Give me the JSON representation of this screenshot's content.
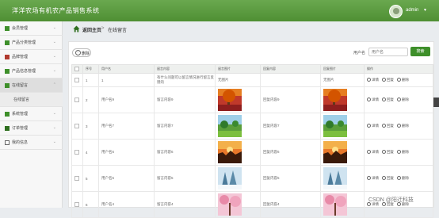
{
  "header": {
    "title": "洋洋农场有机农产品销售系统",
    "user": "admin"
  },
  "sidebar": {
    "items": [
      {
        "label": "会员管理"
      },
      {
        "label": "产品分类管理"
      },
      {
        "label": "品牌管理"
      },
      {
        "label": "产品信息管理"
      },
      {
        "label": "在线留言"
      },
      {
        "label": "在线留言",
        "sub": true
      },
      {
        "label": "系统管理"
      },
      {
        "label": "订单管理"
      },
      {
        "label": "我的信息"
      }
    ]
  },
  "breadcrumb": {
    "home": "返回主页",
    "separator": ">",
    "current": "在线留言"
  },
  "toolbar": {
    "delete_label": "删除",
    "search_label": "用户名",
    "search_placeholder": "用户名",
    "search_button": "搜索"
  },
  "table": {
    "columns": [
      "",
      "序号",
      "用户名",
      "留言内容",
      "留言图片",
      "回复内容",
      "回复图片",
      "操作"
    ],
    "no_image_text": "无图片",
    "actions": {
      "detail": "详情",
      "reply": "回复",
      "delete": "删除"
    },
    "rows": [
      {
        "index": "1",
        "user": "1",
        "content": "有什么问题可以留言情况进行留言反馈的",
        "image": "none",
        "reply": "",
        "reply_image": "none"
      },
      {
        "index": "2",
        "user": "用户名9",
        "content": "留言内容9",
        "image": "autumn",
        "reply": "回复内容9",
        "reply_image": "autumn"
      },
      {
        "index": "3",
        "user": "用户名7",
        "content": "留言内容7",
        "image": "meadow",
        "reply": "回复内容7",
        "reply_image": "meadow"
      },
      {
        "index": "4",
        "user": "用户名6",
        "content": "留言内容6",
        "image": "sunset",
        "reply": "回复内容6",
        "reply_image": "sunset"
      },
      {
        "index": "5",
        "user": "用户名5",
        "content": "留言内容5",
        "image": "winter",
        "reply": "回复内容5",
        "reply_image": "winter"
      },
      {
        "index": "6",
        "user": "用户名4",
        "content": "留言内容4",
        "image": "blossom",
        "reply": "回复内容4",
        "reply_image": "blossom"
      }
    ]
  },
  "watermark": "CSDN @阳迁科技",
  "colors": {
    "accent": "#3e8f2a",
    "topbar": "#5a9a3d"
  }
}
